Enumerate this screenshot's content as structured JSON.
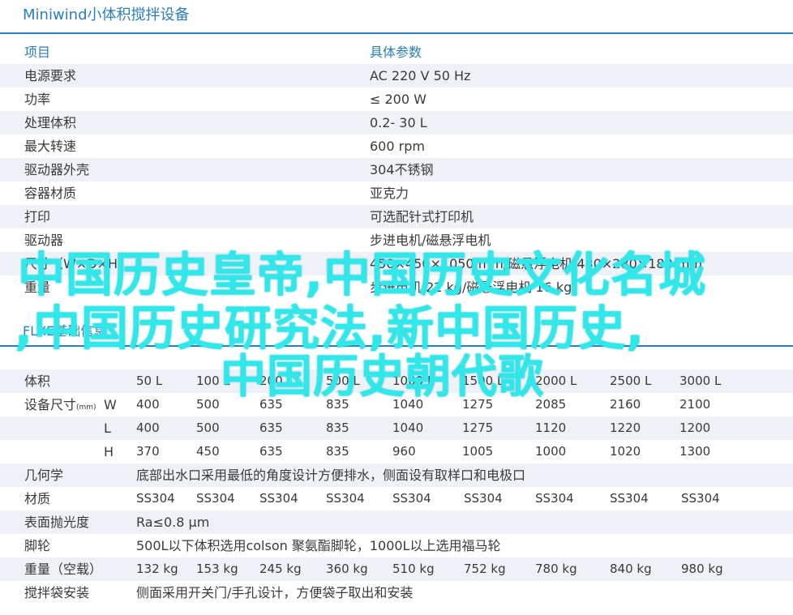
{
  "title": "Miniwind小体积搅拌设备",
  "spec_table": {
    "header": {
      "item": "项目",
      "value": "具体参数"
    },
    "rows": [
      {
        "item": "电源要求",
        "value": "AC 220  V 50 Hz"
      },
      {
        "item": "功率",
        "value": "≤ 200 W"
      },
      {
        "item": "处理体积",
        "value": "0.2- 30 L"
      },
      {
        "item": "最大转速",
        "value": "600  rpm"
      },
      {
        "item": "驱动器外壳",
        "value": "304不锈钢"
      },
      {
        "item": "容器材质",
        "value": "亚克力"
      },
      {
        "item": "打印",
        "value": "可选配针式打印机"
      },
      {
        "item": "驱动器",
        "value": "步进电机/磁悬浮电机"
      },
      {
        "item": "尺寸（W×D×H）",
        "value": "450×450×1050 mm/磁悬浮电机 430×280×180 mm"
      },
      {
        "item": "重量",
        "value": "步进电机 22 kg/磁悬浮电机 16 kg"
      }
    ]
  },
  "flx": {
    "section_title": "FLXE基础信息",
    "volume": {
      "label": "体积",
      "values": [
        "50 L",
        "100 L",
        "200 L",
        "500 L",
        "1000 L",
        "1500 L",
        "2000 L",
        "2500 L",
        "3000 L"
      ]
    },
    "dims_label": "设备尺寸",
    "dims_unit": "(mm)",
    "W": {
      "sub": "W",
      "values": [
        "400",
        "500",
        "635",
        "835",
        "1040",
        "1275",
        "2085",
        "2160",
        "2100"
      ]
    },
    "L": {
      "sub": "L",
      "values": [
        "400",
        "500",
        "635",
        "835",
        "1040",
        "1275",
        "1120",
        "1220",
        "1200"
      ]
    },
    "H": {
      "sub": "H",
      "values": [
        "370",
        "450",
        "635",
        "835",
        "960",
        "1005",
        "1000",
        "1020",
        "1300"
      ]
    },
    "geometry": {
      "label": "几何学",
      "value": "底部出水口采用最低的角度设计方便排水，侧面设有取样口和电极口"
    },
    "material": {
      "label": "材质",
      "values": [
        "SS304",
        "SS304",
        "SS304",
        "SS304",
        "SS304",
        "SS304",
        "SS304",
        "SS304",
        "SS304"
      ]
    },
    "polish": {
      "label": "表面抛光度",
      "value": "Ra≤0.8 μm"
    },
    "wheels": {
      "label": "脚轮",
      "value": "500L以下体积选用colson 聚氨酯脚轮，1000L以上选用福马轮"
    },
    "weight": {
      "label": "重量（空载）",
      "values": [
        "132 kg",
        "153 kg",
        "245 kg",
        "360 kg",
        "510 kg",
        "752 kg",
        "780 kg",
        "840 kg",
        "980 kg"
      ]
    },
    "bag": {
      "label": "搅拌袋安装",
      "value": "侧面采用开关门/手孔设计，方便袋子取出和安装"
    }
  },
  "overlay": {
    "line1": "中国历史皇帝,中国历史文化名城",
    "line2": ",中国历史研究法,新中国历史,",
    "line3": "中国历史朝代歌"
  },
  "colors": {
    "accent": "#2a7fb8",
    "shade": "#eef2f7",
    "overlay": "#2ee8ea"
  }
}
